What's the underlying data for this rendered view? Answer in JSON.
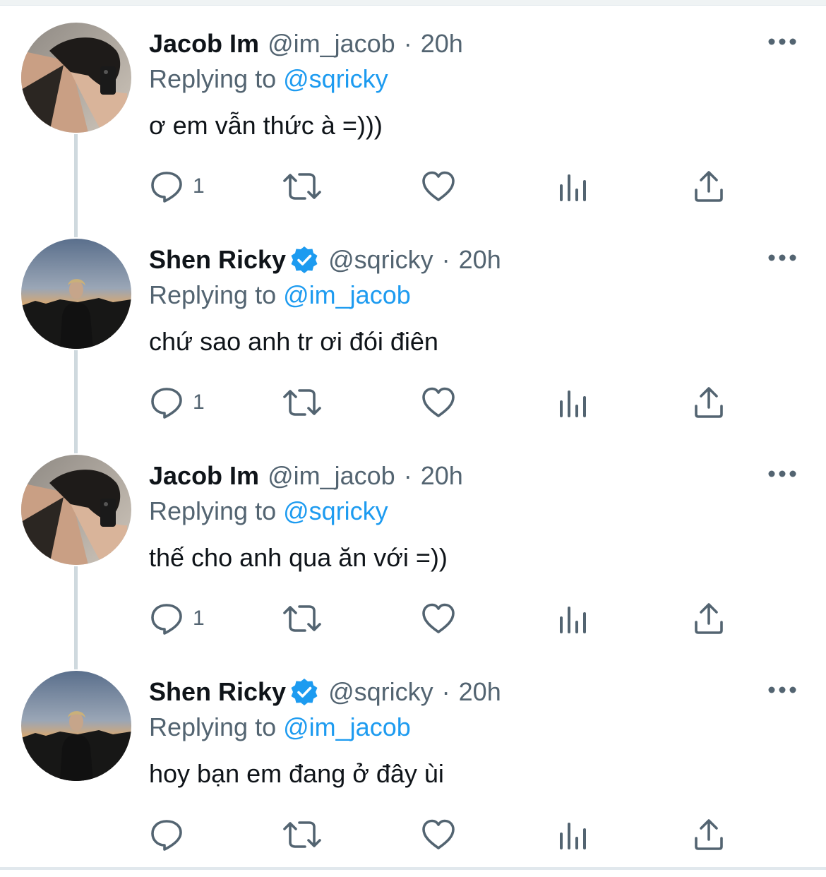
{
  "tweets": [
    {
      "name": "Jacob Im",
      "verified": false,
      "handle": "@im_jacob",
      "separator": "·",
      "time": "20h",
      "replying_prefix": "Replying to",
      "replying_to": "@sqricky",
      "text": "ơ em vẫn thức à =)))",
      "reply_count": "1",
      "avatar": "mirror-selfie"
    },
    {
      "name": "Shen Ricky",
      "verified": true,
      "handle": "@sqricky",
      "separator": "·",
      "time": "20h",
      "replying_prefix": "Replying to",
      "replying_to": "@im_jacob",
      "text": "chứ sao anh tr ơi đói điên",
      "reply_count": "1",
      "avatar": "sunset-portrait"
    },
    {
      "name": "Jacob Im",
      "verified": false,
      "handle": "@im_jacob",
      "separator": "·",
      "time": "20h",
      "replying_prefix": "Replying to",
      "replying_to": "@sqricky",
      "text": "thế cho anh qua ăn với =))",
      "reply_count": "1",
      "avatar": "mirror-selfie"
    },
    {
      "name": "Shen Ricky",
      "verified": true,
      "handle": "@sqricky",
      "separator": "·",
      "time": "20h",
      "replying_prefix": "Replying to",
      "replying_to": "@im_jacob",
      "text": "hoy bạn em đang ở đây ùi",
      "reply_count": "",
      "avatar": "sunset-portrait"
    }
  ],
  "icons": {
    "reply": "reply-icon",
    "retweet": "retweet-icon",
    "like": "heart-icon",
    "views": "views-bar-chart-icon",
    "share": "share-icon",
    "more": "more-dots-icon",
    "verified": "verified-badge-icon"
  },
  "colors": {
    "link": "#1d9bf0",
    "secondary_text": "#536471",
    "primary_text": "#0f1419",
    "thread_line": "#cfd9de"
  }
}
